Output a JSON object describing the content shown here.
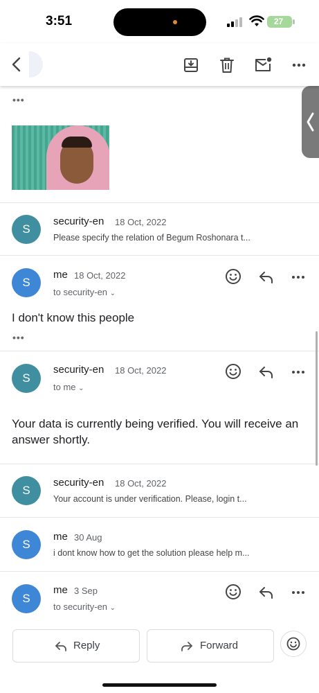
{
  "status": {
    "time": "3:51",
    "battery": "27"
  },
  "toolbar": {
    "back": "back-arrow-icon",
    "actions": [
      "archive-icon",
      "delete-icon",
      "mark-unread-icon",
      "more-icon"
    ]
  },
  "thread": {
    "messages": [
      {
        "sender": "security-en",
        "date": "18 Oct, 2022",
        "avatar": "S",
        "snippet": "Please specify the relation of Begum Roshonara t..."
      },
      {
        "sender": "me",
        "date": "18 Oct, 2022",
        "avatar": "S",
        "to": "to security-en",
        "body": "I don't know this people"
      },
      {
        "sender": "security-en",
        "date": "18 Oct, 2022",
        "avatar": "S",
        "to": "to me",
        "body": "Your data is currently being verified. You will receive an answer shortly."
      },
      {
        "sender": "security-en",
        "date": "18 Oct, 2022",
        "avatar": "S",
        "snippet": "Your account is under verification. Please, login t..."
      },
      {
        "sender": "me",
        "date": "30 Aug",
        "avatar": "S",
        "snippet": "i dont know how to get the solution please help m..."
      },
      {
        "sender": "me",
        "date": "3 Sep",
        "avatar": "S",
        "to": "to security-en"
      }
    ]
  },
  "footer": {
    "reply_label": "Reply",
    "forward_label": "Forward"
  },
  "colors": {
    "avatar_teal": "#3f8fa0",
    "avatar_blue": "#3e86d6",
    "battery": "#a6d89b"
  }
}
